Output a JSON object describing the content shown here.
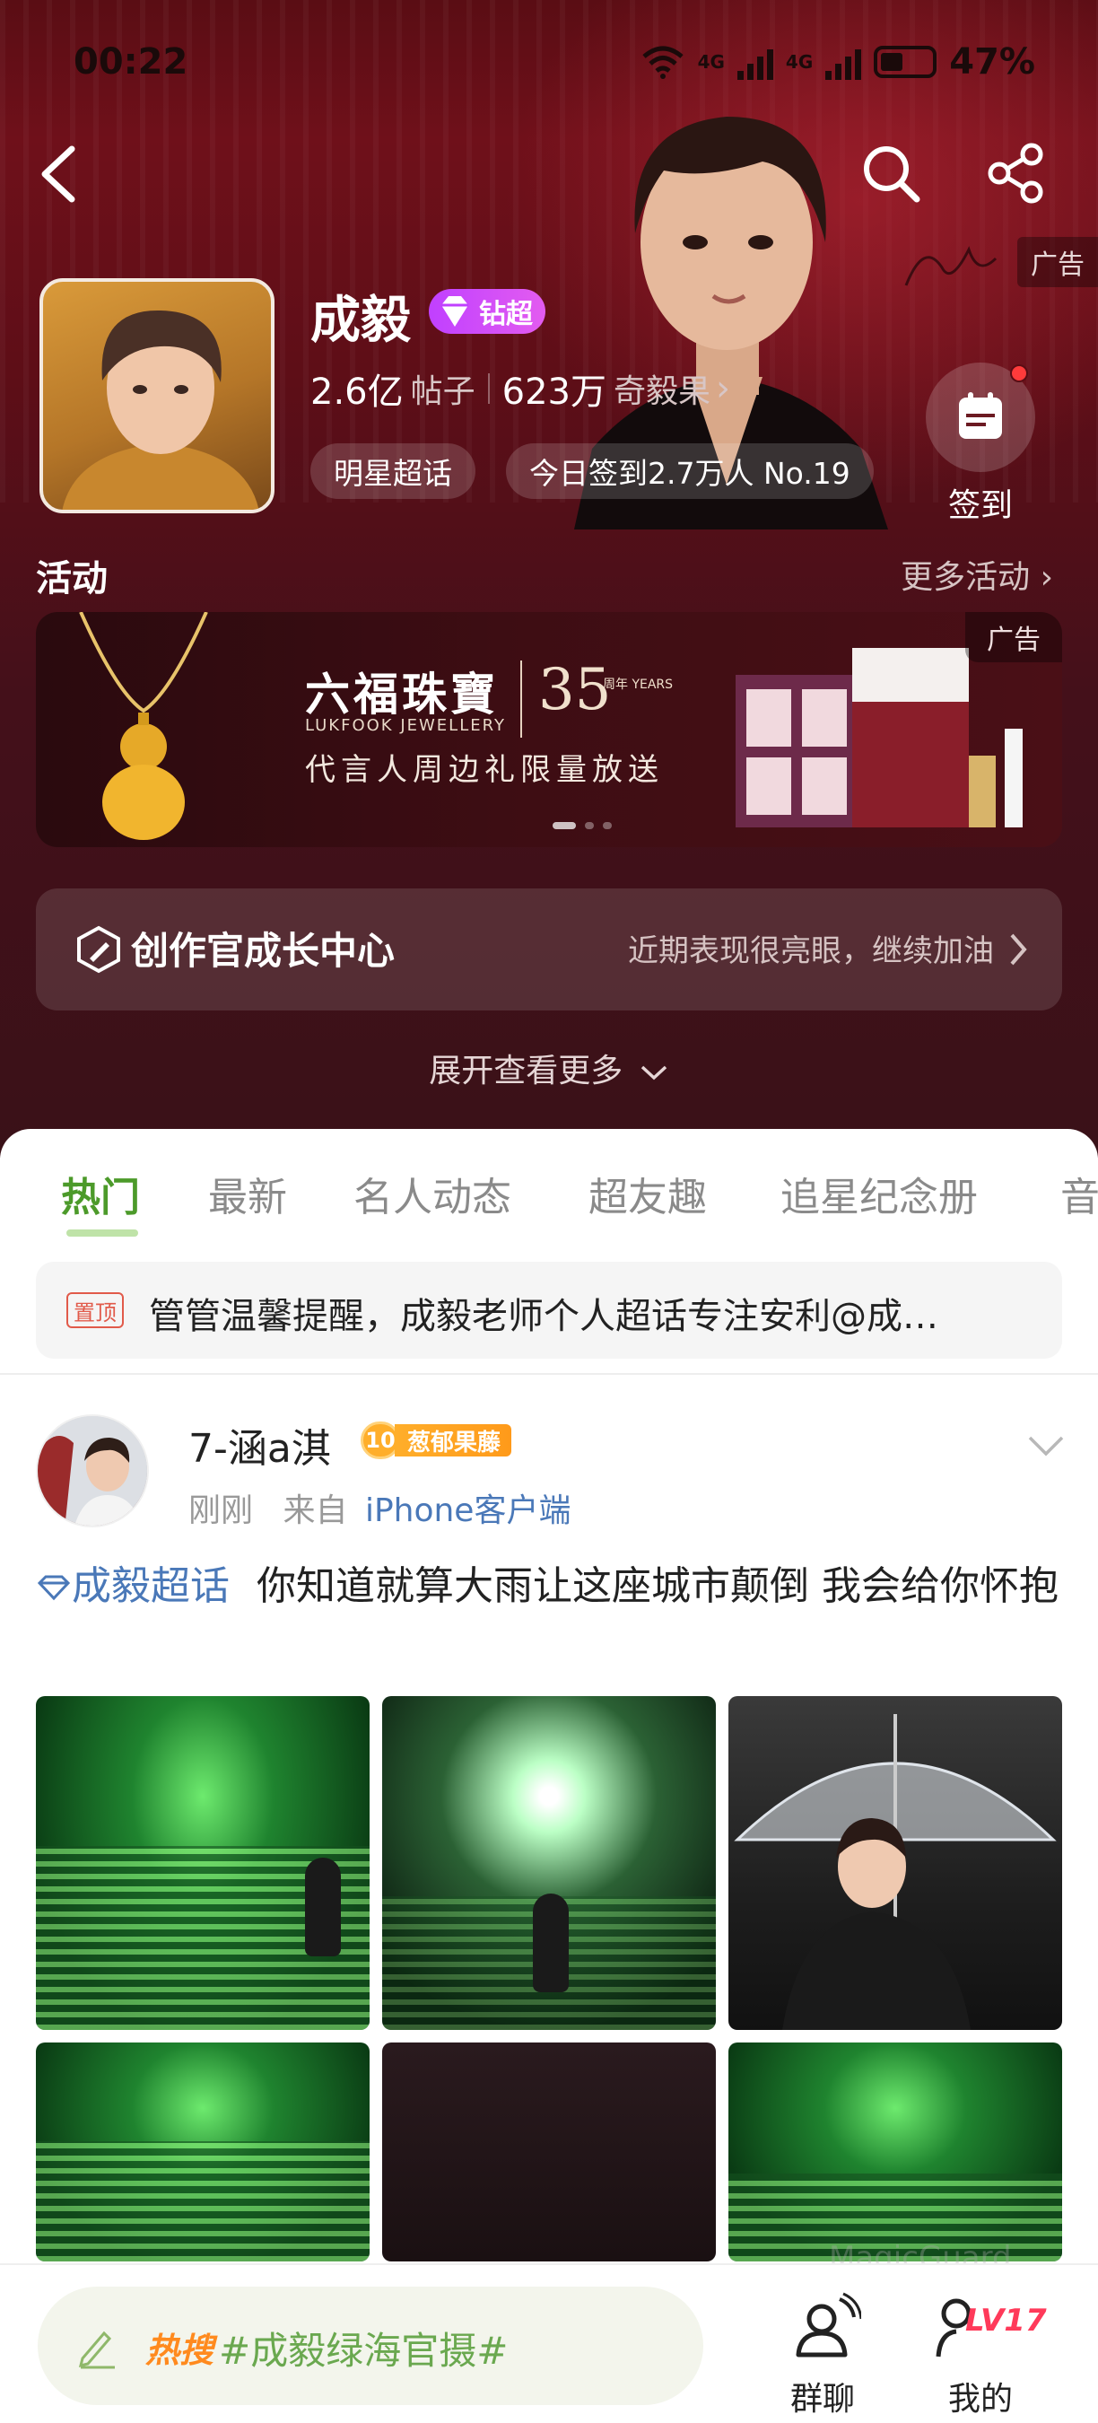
{
  "status_bar": {
    "time": "00:22",
    "network_1": "4G",
    "network_2": "4G",
    "battery": "47%"
  },
  "header": {
    "ad_label": "广告",
    "icons": [
      "back-icon",
      "search-icon",
      "share-icon"
    ]
  },
  "profile": {
    "name": "成毅",
    "badge_label": "钻超",
    "posts_count": "2.6亿",
    "posts_label": "帖子",
    "fans_count": "623万",
    "fans_label": "奇毅果",
    "chevron": "›",
    "chip_star": "明星超话",
    "chip_checkin": "今日签到2.7万人 No.19",
    "checkin_label": "签到"
  },
  "activities": {
    "title": "活动",
    "more": "更多活动 ›",
    "banner": {
      "brand_cn": "六福珠寶",
      "brand_en": "LUKFOOK JEWELLERY",
      "years": "35",
      "years_sub": "周年 YEARS",
      "slogan": "代言人周边礼限量放送",
      "ad_label": "广告"
    }
  },
  "growth_center": {
    "title": "创作官成长中心",
    "subtitle": "近期表现很亮眼，继续加油"
  },
  "expand_more": "展开查看更多",
  "tabs": [
    "热门",
    "最新",
    "名人动态",
    "超友趣",
    "追星纪念册",
    "音"
  ],
  "pinned": {
    "tag": "置顶",
    "text": "管管温馨提醒，成毅老师个人超话专注安利@成…"
  },
  "post": {
    "author": "7-涵a淇",
    "fan_level": "10",
    "fan_group": "葱郁果藤",
    "time": "刚刚",
    "from_label": "来自",
    "source": "iPhone客户端",
    "topic": "成毅超话",
    "text": "你知道就算大雨让这座城市颠倒 我会给你怀抱"
  },
  "bottom_bar": {
    "hot_label": "热搜",
    "hot_query": "#成毅绿海官摄#",
    "group_chat": "群聊",
    "me": "我的",
    "level": "LV17",
    "watermark": "MagicGuard"
  }
}
